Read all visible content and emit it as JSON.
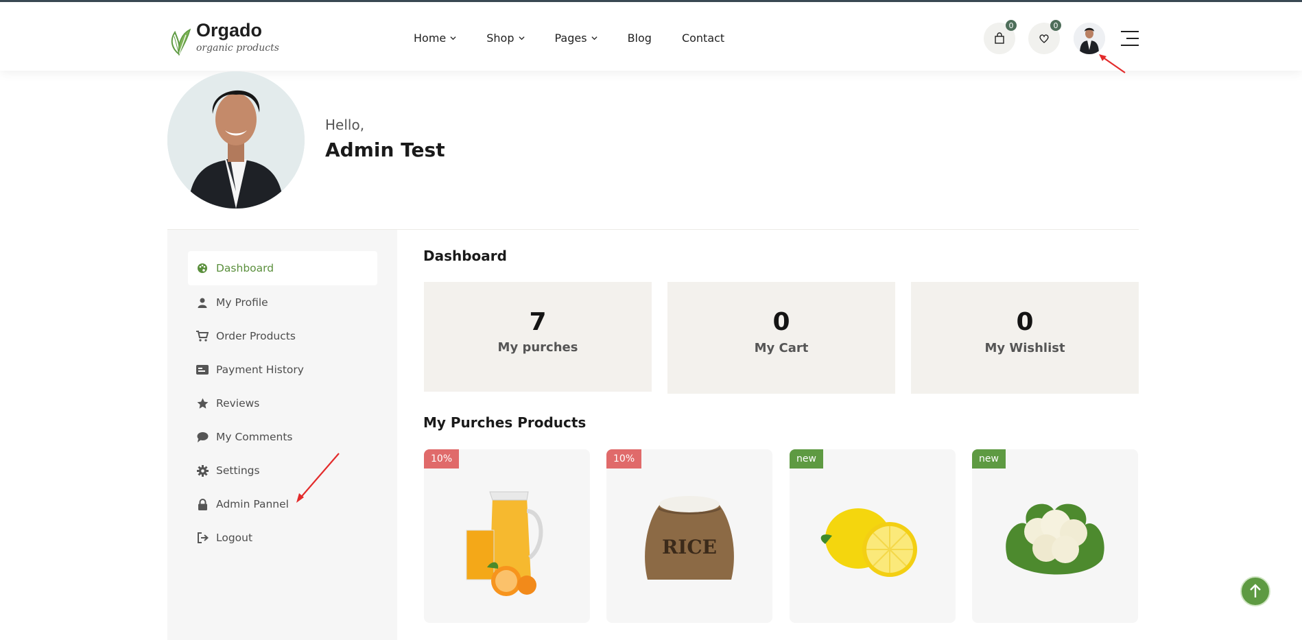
{
  "logo": {
    "title": "Orgado",
    "subtitle": "organic products"
  },
  "nav": [
    {
      "label": "Home",
      "dropdown": true
    },
    {
      "label": "Shop",
      "dropdown": true
    },
    {
      "label": "Pages",
      "dropdown": true
    },
    {
      "label": "Blog",
      "dropdown": false
    },
    {
      "label": "Contact",
      "dropdown": false
    }
  ],
  "header_actions": {
    "cart_count": "0",
    "wishlist_count": "0"
  },
  "profile": {
    "greeting": "Hello,",
    "name": "Admin Test"
  },
  "sidebar": {
    "items": [
      {
        "label": "Dashboard",
        "icon": "palette-icon",
        "active": true
      },
      {
        "label": "My Profile",
        "icon": "user-icon",
        "active": false
      },
      {
        "label": "Order Products",
        "icon": "cart-icon",
        "active": false
      },
      {
        "label": "Payment History",
        "icon": "id-card-icon",
        "active": false
      },
      {
        "label": "Reviews",
        "icon": "star-icon",
        "active": false
      },
      {
        "label": "My Comments",
        "icon": "comment-icon",
        "active": false
      },
      {
        "label": "Settings",
        "icon": "gear-icon",
        "active": false
      },
      {
        "label": "Admin Pannel",
        "icon": "lock-icon",
        "active": false
      },
      {
        "label": "Logout",
        "icon": "logout-icon",
        "active": false
      }
    ]
  },
  "dashboard": {
    "title": "Dashboard",
    "stats": [
      {
        "value": "7",
        "label": "My purches"
      },
      {
        "value": "0",
        "label": "My Cart"
      },
      {
        "value": "0",
        "label": "My Wishlist"
      }
    ]
  },
  "products": {
    "title": "My Purches Products",
    "items": [
      {
        "tag": "10%",
        "tag_color": "#e06a6a",
        "image": "orange-juice-image"
      },
      {
        "tag": "10%",
        "tag_color": "#e06a6a",
        "image": "rice-sack-image"
      },
      {
        "tag": "new",
        "tag_color": "#5e9a42",
        "image": "lemon-image"
      },
      {
        "tag": "new",
        "tag_color": "#5e9a42",
        "image": "cauliflower-image"
      }
    ]
  },
  "colors": {
    "accent": "#5e9a42",
    "sale": "#e06a6a",
    "card_bg": "#f3f1ed",
    "sidebar_bg": "#f6f6f6",
    "annotation_arrow": "#e32b2b"
  }
}
